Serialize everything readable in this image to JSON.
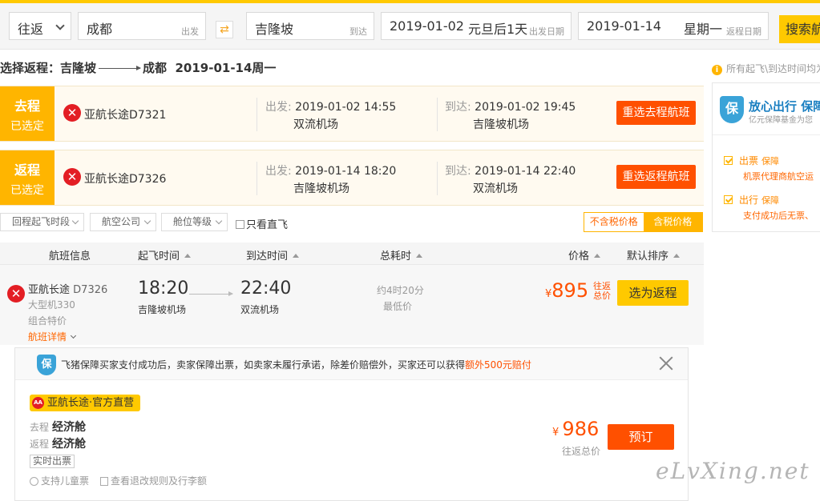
{
  "search": {
    "trip_type": "往返",
    "from_city": "成都",
    "from_label": "出发",
    "to_city": "吉隆坡",
    "to_label": "到达",
    "depart_date": "2019-01-02",
    "depart_note": "元旦后1天",
    "depart_label": "出发日期",
    "return_date": "2019-01-14",
    "return_note": "星期一",
    "return_label": "返程日期",
    "search_button": "搜索航"
  },
  "selection": {
    "prefix": "选择返程：吉隆坡",
    "to": "成都",
    "date": "2019-01-14周一"
  },
  "legs": [
    {
      "tag_top": "去程",
      "tag_bottom": "已选定",
      "flight": "亚航长途D7321",
      "dep_label": "出发:",
      "dep_time": "2019-01-02 14:55",
      "dep_airport": "双流机场",
      "arr_label": "到达:",
      "arr_time": "2019-01-02 19:45",
      "arr_airport": "吉隆坡机场",
      "button": "重选去程航班"
    },
    {
      "tag_top": "返程",
      "tag_bottom": "已选定",
      "flight": "亚航长途D7326",
      "dep_label": "出发:",
      "dep_time": "2019-01-14 18:20",
      "dep_airport": "吉隆坡机场",
      "arr_label": "到达:",
      "arr_time": "2019-01-14 22:40",
      "arr_airport": "双流机场",
      "button": "重选返程航班"
    }
  ],
  "filters": {
    "f1": "回程起飞时段",
    "f2": "航空公司",
    "f3": "舱位等级",
    "direct": "只看直飞",
    "price_excl": "不含税价格",
    "price_incl": "含税价格"
  },
  "table_header": {
    "info": "航班信息",
    "dep": "起飞时间",
    "arr": "到达时间",
    "dur": "总耗时",
    "price": "价格",
    "sort": "默认排序"
  },
  "flight": {
    "airline": "亚航长途",
    "number": "D7326",
    "aircraft": "大型机330",
    "special": "组合特价",
    "details": "航班详情",
    "dep_time": "18:20",
    "dep_airport": "吉隆坡机场",
    "arr_time": "22:40",
    "arr_airport": "双流机场",
    "duration": "约4时20分",
    "lowest": "最低价",
    "currency": "¥",
    "price": "895",
    "price_tag": "往返总价",
    "select_button": "选为返程"
  },
  "notice": {
    "text": "飞猪保障买家支付成功后，卖家保障出票，如卖家未履行承诺，除差价赔偿外，买家还可以获得",
    "highlight": "额外500元赔付",
    "shield": "保"
  },
  "offer": {
    "vendor": "亚航长途·官方直营",
    "vendor_logo": "AirAsia",
    "outbound_label": "去程",
    "outbound_cabin": "经济舱",
    "return_label": "返程",
    "return_cabin": "经济舱",
    "realtime": "实时出票",
    "child_ticket": "支持儿童票",
    "rules": "查看退改规则及行李额",
    "currency": "¥",
    "price": "986",
    "price_label": "往返总价",
    "book_button": "预订"
  },
  "side": {
    "info": "所有起飞\\到达时间均为",
    "shield": "保",
    "title": "放心出行 保障",
    "subtitle": "亿元保障基金为您",
    "item1_title": "出票",
    "item1_badge": "保障",
    "item1_desc": "机票代理商航空运",
    "item2_title": "出行",
    "item2_badge": "保障",
    "item2_desc": "支付成功后无票、"
  },
  "watermark": "eLvXing.net",
  "colors": {
    "brand_yellow": "#ffc900",
    "accent_orange": "#ff5000",
    "tag_yellow": "#ffb500",
    "airline_red": "#e31e24",
    "shield_blue": "#3aa3d8"
  },
  "icons": {
    "swap": "swap-icon",
    "airline": "airasia-logo-icon",
    "info": "info-icon",
    "shield": "shield-icon",
    "close": "close-icon",
    "check": "check-icon"
  }
}
